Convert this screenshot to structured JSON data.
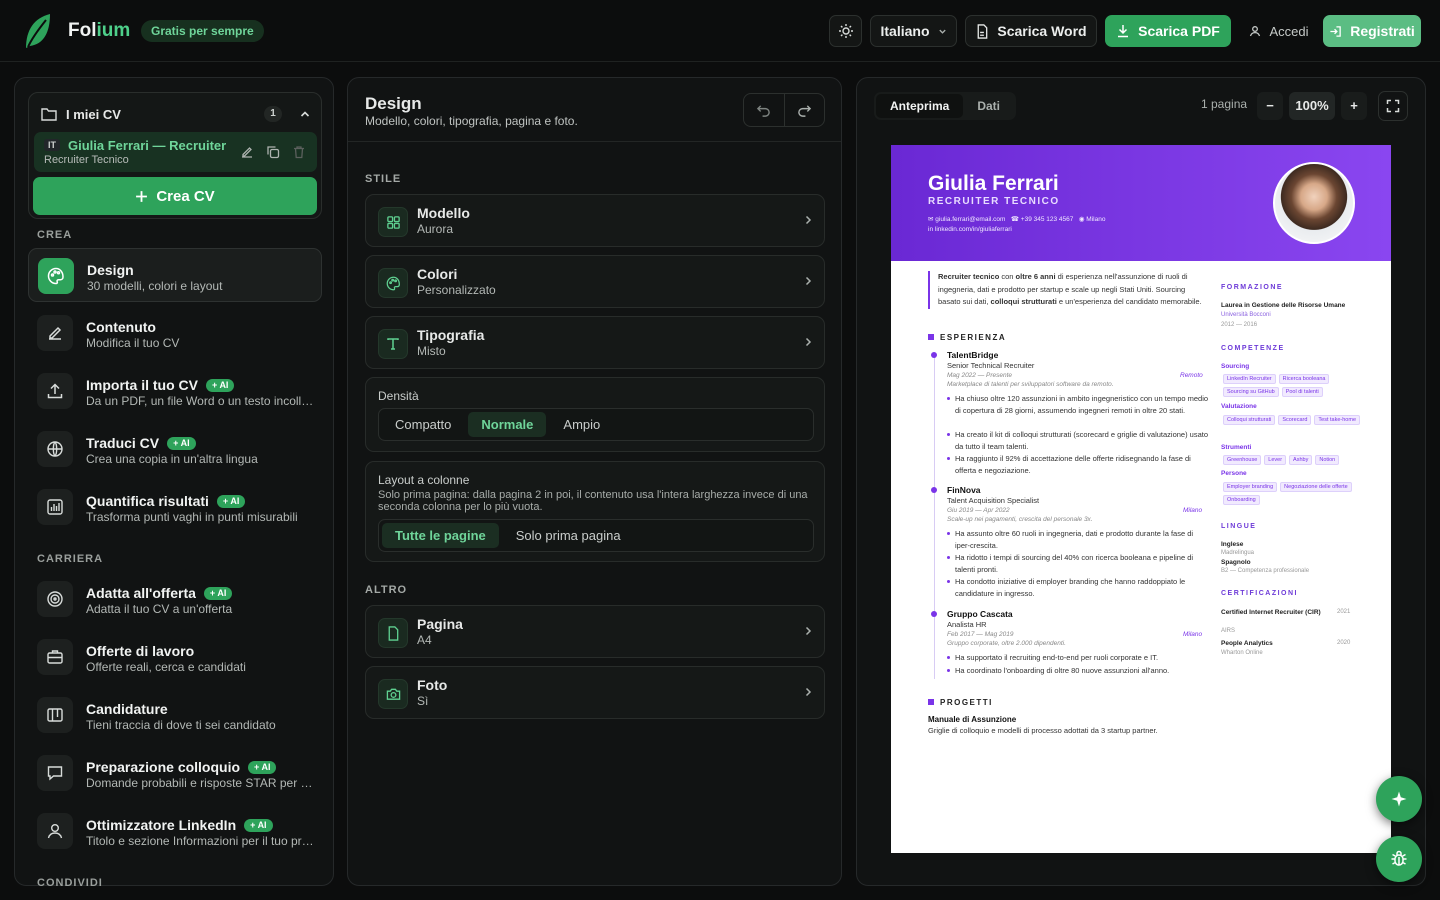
{
  "topbar": {
    "brand_a": "Fol",
    "brand_b": "ium",
    "free_badge": "Gratis per sempre",
    "language": "Italiano",
    "download_word": "Scarica Word",
    "download_pdf": "Scarica PDF",
    "login": "Accedi",
    "register": "Registrati"
  },
  "sidebar": {
    "my_cvs_title": "I miei CV",
    "my_cvs_count": "1",
    "cv_lang": "IT",
    "cv_name": "Giulia Ferrari — Recruiter",
    "cv_sub": "Recruiter Tecnico",
    "create_cv": "Crea CV",
    "section_create": "CREA",
    "section_career": "CARRIERA",
    "section_share": "CONDIVIDI",
    "ai_badge": "AI",
    "items": [
      {
        "title": "Design",
        "desc": "30 modelli, colori e layout",
        "icon": "palette-icon"
      },
      {
        "title": "Contenuto",
        "desc": "Modifica il tuo CV",
        "icon": "pencil-icon"
      },
      {
        "title": "Importa il tuo CV",
        "desc": "Da un PDF, un file Word o un testo incollato",
        "icon": "upload-icon"
      },
      {
        "title": "Traduci CV",
        "desc": "Crea una copia in un'altra lingua",
        "icon": "globe-icon"
      },
      {
        "title": "Quantifica risultati",
        "desc": "Trasforma punti vaghi in punti misurabili",
        "icon": "bar-chart-icon"
      },
      {
        "title": "Adatta all'offerta",
        "desc": "Adatta il tuo CV a un'offerta",
        "icon": "target-icon"
      },
      {
        "title": "Offerte di lavoro",
        "desc": "Offerte reali, cerca e candidati",
        "icon": "briefcase-icon"
      },
      {
        "title": "Candidature",
        "desc": "Tieni traccia di dove ti sei candidato",
        "icon": "kanban-icon"
      },
      {
        "title": "Preparazione colloquio",
        "desc": "Domande probabili e risposte STAR per il colloquio",
        "icon": "chat-icon"
      },
      {
        "title": "Ottimizzatore LinkedIn",
        "desc": "Titolo e sezione Informazioni per il tuo profilo",
        "icon": "user-icon"
      }
    ]
  },
  "design": {
    "title": "Design",
    "subtitle": "Modello, colori, tipografia, pagina e foto.",
    "section_style": "STILE",
    "section_other": "ALTRO",
    "rows": [
      {
        "title": "Modello",
        "value": "Aurora"
      },
      {
        "title": "Colori",
        "value": "Personalizzato"
      },
      {
        "title": "Tipografia",
        "value": "Misto"
      },
      {
        "title": "Pagina",
        "value": "A4"
      },
      {
        "title": "Foto",
        "value": "Sì"
      }
    ],
    "density_label": "Densità",
    "density_options": [
      "Compatto",
      "Normale",
      "Ampio"
    ],
    "density_selected": "Normale",
    "layout_label": "Layout a colonne",
    "layout_desc": "Solo prima pagina: dalla pagina 2 in poi, il contenuto usa l'intera larghezza invece di una seconda colonna per lo più vuota.",
    "layout_options": [
      "Tutte le pagine",
      "Solo prima pagina"
    ],
    "layout_selected": "Tutte le pagine"
  },
  "preview": {
    "tab_preview": "Anteprima",
    "tab_data": "Dati",
    "pages": "1 pagina",
    "zoom_minus": "−",
    "zoom": "100%",
    "zoom_plus": "+"
  },
  "resume": {
    "name": "Giulia Ferrari",
    "role": "RECRUITER TECNICO",
    "email": "giulia.ferrari@email.com",
    "phone": "+39 345 123 4567",
    "city": "Milano",
    "linkedin": "linkedin.com/in/giuliaferrari",
    "summary_a": "Recruiter tecnico",
    "summary_b": " con ",
    "summary_c": "oltre 6 anni",
    "summary_d": " di esperienza nell'assunzione di ruoli di ingegneria, dati e prodotto per startup e scale up negli Stati Uniti. Sourcing basato sui dati, ",
    "summary_e": "colloqui strutturati",
    "summary_f": " e un'esperienza del candidato memorabile.",
    "experience_title": "ESPERIENZA",
    "jobs": [
      {
        "company": "TalentBridge",
        "role": "Senior Technical Recruiter",
        "dates": "Mag 2022 — Presente",
        "location": "Remoto",
        "meta": "Marketplace di talenti per sviluppatori software da remoto.",
        "bullets": [
          "Ha chiuso oltre 120 assunzioni in ambito ingegneristico con un tempo medio di copertura di 28 giorni, assumendo ingegneri remoti in oltre 20 stati.",
          "Ha creato il kit di colloqui strutturati (scorecard e griglie di valutazione) usato da tutto il team talenti.",
          "Ha raggiunto il 92% di accettazione delle offerte ridisegnando la fase di offerta e negoziazione."
        ]
      },
      {
        "company": "FinNova",
        "role": "Talent Acquisition Specialist",
        "dates": "Giu 2019 — Apr 2022",
        "location": "Milano",
        "meta": "Scale-up nei pagamenti, crescita del personale 3x.",
        "bullets": [
          "Ha assunto oltre 60 ruoli in ingegneria, dati e prodotto durante la fase di iper-crescita.",
          "Ha ridotto i tempi di sourcing del 40% con ricerca booleana e pipeline di talenti pronti.",
          "Ha condotto iniziative di employer branding che hanno raddoppiato le candidature in ingresso."
        ]
      },
      {
        "company": "Gruppo Cascata",
        "role": "Analista HR",
        "dates": "Feb 2017 — Mag 2019",
        "location": "Milano",
        "meta": "Gruppo corporate, oltre 2.000 dipendenti.",
        "bullets": [
          "Ha supportato il recruiting end-to-end per ruoli corporate e IT.",
          "Ha coordinato l'onboarding di oltre 80 nuove assunzioni all'anno."
        ]
      }
    ],
    "projects_title": "PROGETTI",
    "project_name": "Manuale di Assunzione",
    "project_desc": "Griglie di colloquio e modelli di processo adottati da 3 startup partner.",
    "education_title": "FORMAZIONE",
    "degree": "Laurea in Gestione delle Risorse Umane",
    "school": "Università Bocconi",
    "edu_years": "2012 — 2016",
    "skills_title": "COMPETENZE",
    "skill_groups": [
      {
        "name": "Sourcing",
        "tags": [
          "LinkedIn Recruiter",
          "Ricerca booleana",
          "Sourcing su GitHub",
          "Pool di talenti"
        ]
      },
      {
        "name": "Valutazione",
        "tags": [
          "Colloqui strutturati",
          "Scorecard",
          "Test take-home"
        ]
      },
      {
        "name": "Strumenti",
        "tags": [
          "Greenhouse",
          "Lever",
          "Ashby",
          "Notion"
        ]
      },
      {
        "name": "Persone",
        "tags": [
          "Employer branding",
          "Negoziazione delle offerte",
          "Onboarding"
        ]
      }
    ],
    "languages_title": "LINGUE",
    "lang1": "Inglese",
    "lang1_level": "Madrelingua",
    "lang2": "Spagnolo",
    "lang2_level": "B2 — Competenza professionale",
    "certs_title": "CERTIFICAZIONI",
    "cert1": "Certified Internet Recruiter (CIR)",
    "cert1_org": "AIRS",
    "cert1_year": "2021",
    "cert2": "People Analytics",
    "cert2_org": "Wharton Online",
    "cert2_year": "2020"
  },
  "colors": {
    "accent": "#2ea35b",
    "resume_accent": "#7a34e8"
  }
}
